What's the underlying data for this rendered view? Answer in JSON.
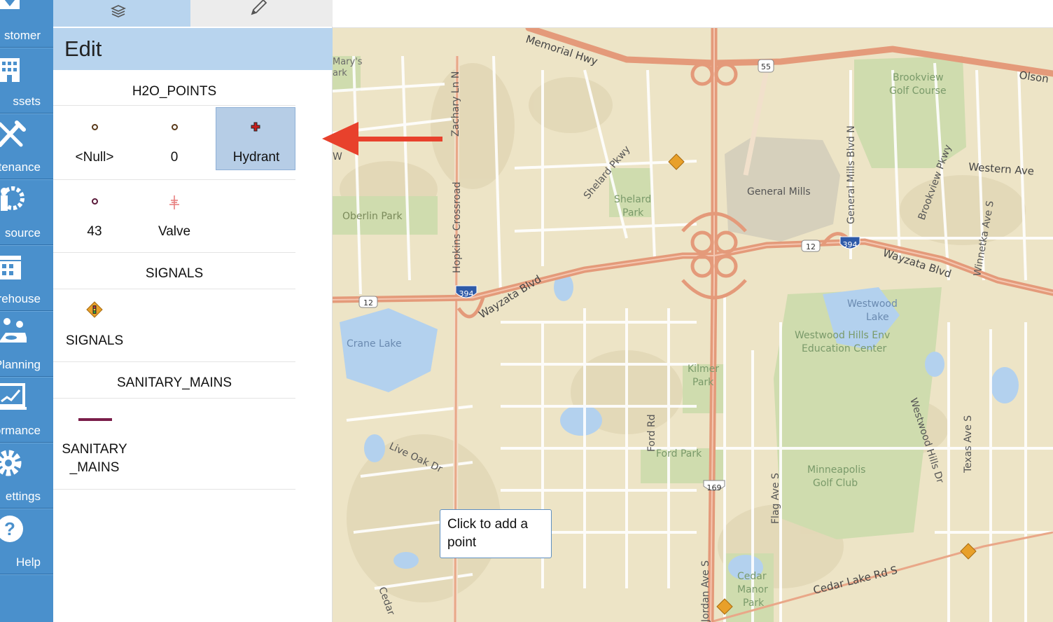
{
  "nav": {
    "items": [
      {
        "label": "stomer",
        "icon": "customer-icon"
      },
      {
        "label": "ssets",
        "icon": "assets-building-icon"
      },
      {
        "label": "ntenance",
        "icon": "maintenance-tools-icon"
      },
      {
        "label": "source",
        "icon": "resource-gear-person-icon"
      },
      {
        "label": "rehouse",
        "icon": "warehouse-icon"
      },
      {
        "label": "Planning",
        "icon": "planning-icon"
      },
      {
        "label": "ormance",
        "icon": "performance-chart-icon"
      },
      {
        "label": "ettings",
        "icon": "settings-gear-icon"
      },
      {
        "label": "Help",
        "icon": "help-question-icon"
      }
    ]
  },
  "panel": {
    "tabs": [
      {
        "icon": "layers-icon"
      },
      {
        "icon": "pencil-icon"
      }
    ],
    "title": "Edit",
    "layers": [
      {
        "name": "H2O_POINTS",
        "templates": [
          "<Null>",
          "0",
          "Hydrant",
          "43",
          "Valve"
        ],
        "selected": "Hydrant"
      },
      {
        "name": "SIGNALS",
        "templates": [
          "SIGNALS"
        ]
      },
      {
        "name": "SANITARY_MAINS",
        "templates": [
          "SANITARY\n_MAINS"
        ]
      }
    ]
  },
  "map": {
    "tooltip": "Click to add a point",
    "labels": {
      "memorial_hwy": "Memorial Hwy",
      "olson": "Olson",
      "marys_park_1": "Mary's",
      "marys_park_2": "ark",
      "zachary": "Zachary Ln N",
      "brookview_1": "Brookview",
      "brookview_2": "Golf Course",
      "general_mills_blvd": "General Mills Blvd N",
      "brookview_pkwy": "Brookview Pkwy",
      "western_ave": "Western Ave",
      "shelard_pkwy": "Shelard Pkwy",
      "shelard_park_1": "Shelard",
      "shelard_park_2": "Park",
      "general_mills": "General Mills",
      "oberlin": "Oberlin Park",
      "hopkins": "Hopkins Crossroad",
      "winnetka": "Winnetka Ave S",
      "wayzata_w": "Wayzata Blvd",
      "wayzata_e": "Wayzata Blvd",
      "westwood_lake_1": "Westwood",
      "westwood_lake_2": "Lake",
      "westwood_hills_1": "Westwood Hills Env",
      "westwood_hills_2": "Education Center",
      "crane_lake": "Crane Lake",
      "kilmer_1": "Kilmer",
      "kilmer_2": "Park",
      "ford_rd": "Ford Rd",
      "ford_park": "Ford Park",
      "live_oak": "Live Oak Dr",
      "flag_ave": "Flag Ave S",
      "minneapolis_1": "Minneapolis",
      "minneapolis_2": "Golf Club",
      "westwood_hills_dr": "Westwood Hills Dr",
      "texas_ave": "Texas Ave S",
      "cedar_lake_rd": "Cedar Lake Rd S",
      "cedar_manor_1": "Cedar",
      "cedar_manor_2": "Manor",
      "cedar_manor_3": "Park",
      "jordan": "Jordan Ave S",
      "cedar_sw": "Cedar",
      "w_edge": "W",
      "shield_55": "55",
      "shield_12a": "12",
      "shield_394a": "394",
      "shield_12b": "12",
      "shield_394b": "394",
      "shield_169": "169"
    }
  },
  "colors": {
    "nav_bg": "#4a90cc",
    "panel_header": "#b8d4ee",
    "selected_template": "#b6cde6",
    "map_land": "#ede4c6",
    "road_major": "#e49a7a",
    "water": "#b3d1ee",
    "park": "#cfdcae",
    "arrow": "#e8412c",
    "sanitary_main": "#7a1e4a"
  }
}
